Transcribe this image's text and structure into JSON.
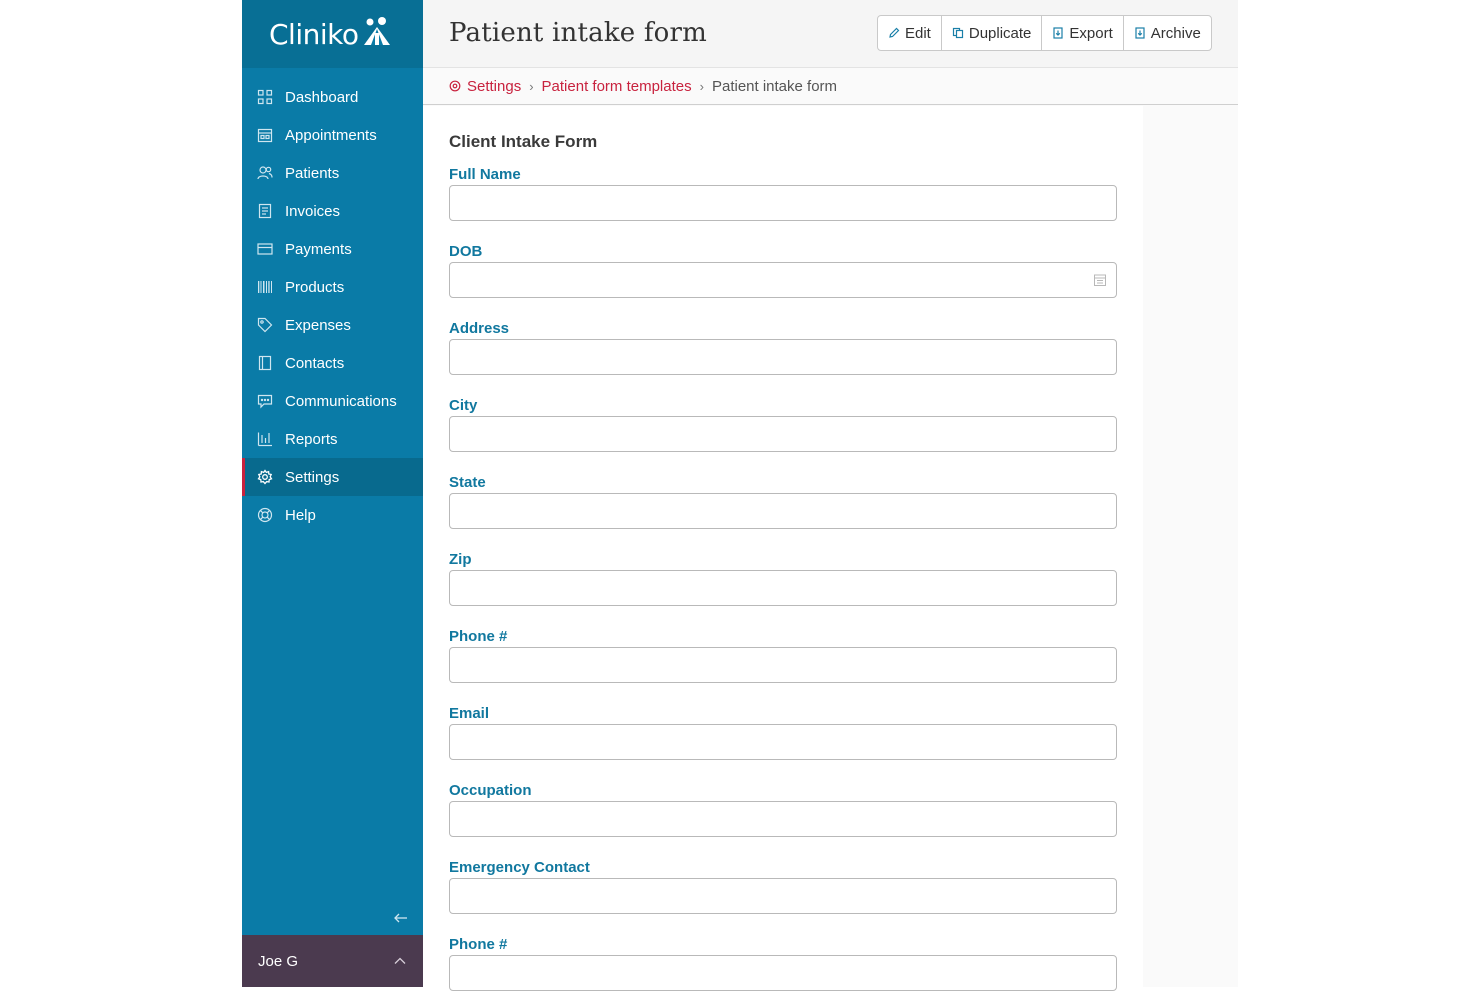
{
  "brand": {
    "name": "Cliniko"
  },
  "sidebar": {
    "items": [
      {
        "label": "Dashboard",
        "icon": "dashboard-icon"
      },
      {
        "label": "Appointments",
        "icon": "calendar-icon"
      },
      {
        "label": "Patients",
        "icon": "patients-icon"
      },
      {
        "label": "Invoices",
        "icon": "invoice-icon"
      },
      {
        "label": "Payments",
        "icon": "card-icon"
      },
      {
        "label": "Products",
        "icon": "barcode-icon"
      },
      {
        "label": "Expenses",
        "icon": "tag-icon"
      },
      {
        "label": "Contacts",
        "icon": "address-book-icon"
      },
      {
        "label": "Communications",
        "icon": "chat-icon"
      },
      {
        "label": "Reports",
        "icon": "bar-chart-icon"
      },
      {
        "label": "Settings",
        "icon": "gear-icon",
        "active": true
      },
      {
        "label": "Help",
        "icon": "lifebuoy-icon"
      }
    ],
    "user": "Joe G"
  },
  "header": {
    "title": "Patient intake form",
    "buttons": {
      "edit": "Edit",
      "duplicate": "Duplicate",
      "export": "Export",
      "archive": "Archive"
    }
  },
  "breadcrumb": {
    "settings": "Settings",
    "templates": "Patient form templates",
    "current": "Patient intake form"
  },
  "form": {
    "title": "Client Intake Form",
    "fields": [
      {
        "label": "Full Name",
        "value": ""
      },
      {
        "label": "DOB",
        "value": ""
      },
      {
        "label": "Address",
        "value": ""
      },
      {
        "label": "City",
        "value": ""
      },
      {
        "label": "State",
        "value": ""
      },
      {
        "label": "Zip",
        "value": ""
      },
      {
        "label": "Phone #",
        "value": ""
      },
      {
        "label": "Email",
        "value": ""
      },
      {
        "label": "Occupation",
        "value": ""
      },
      {
        "label": "Emergency Contact",
        "value": ""
      },
      {
        "label": "Phone #",
        "value": ""
      }
    ]
  },
  "colors": {
    "sidebar": "#0a7ba7",
    "accent": "#c8223e",
    "label": "#11789f",
    "user_bar": "#4b3a4f"
  }
}
